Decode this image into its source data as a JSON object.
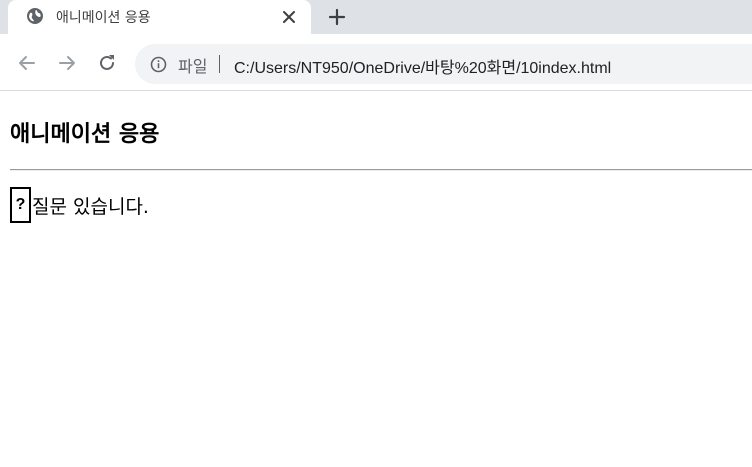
{
  "browser": {
    "tab": {
      "title": "애니메이션 응용",
      "favicon": "globe-icon",
      "close_icon": "close-icon"
    },
    "new_tab_icon": "plus-icon",
    "nav": {
      "back_icon": "arrow-left-icon",
      "forward_icon": "arrow-right-icon",
      "reload_icon": "reload-icon"
    },
    "omnibox": {
      "info_icon": "info-icon",
      "scheme_label": "파일",
      "url": "C:/Users/NT950/OneDrive/바탕%20화면/10index.html"
    }
  },
  "page": {
    "title": "애니메이션 응용",
    "question_mark": "?",
    "question_text": "질문 있습니다."
  },
  "colors": {
    "tabstrip_bg": "#dee1e6",
    "omnibox_bg": "#f1f3f4",
    "icon_gray": "#5f6368",
    "text_dark": "#202124"
  }
}
